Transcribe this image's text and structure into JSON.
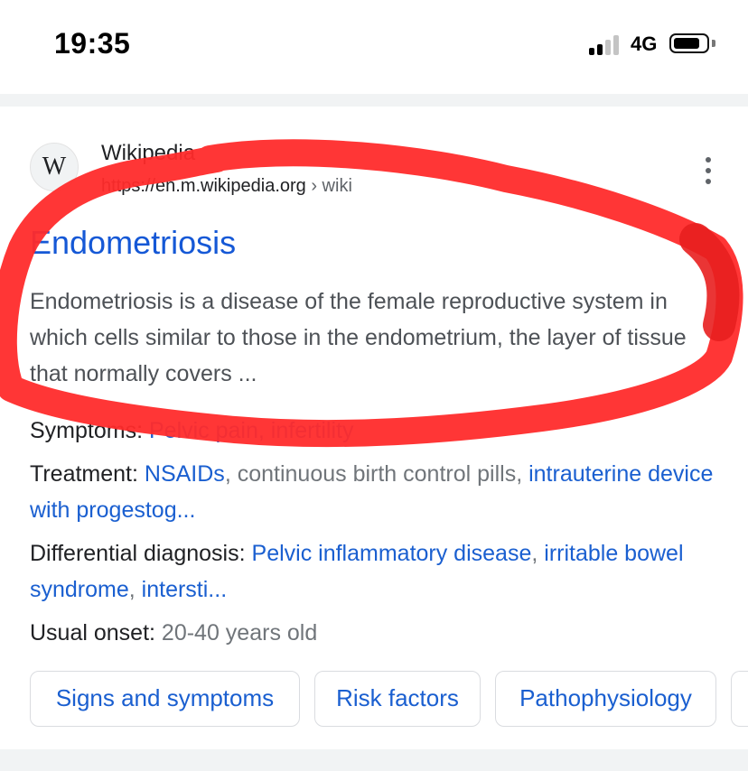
{
  "status_bar": {
    "time": "19:35",
    "network": "4G",
    "signal_icon": "cell-signal-icon",
    "battery_icon": "battery-icon"
  },
  "result": {
    "favicon_letter": "W",
    "site_name": "Wikipedia",
    "url": "https://en.m.wikipedia.org",
    "breadcrumb": " › wiki",
    "more_icon": "more-vert-icon",
    "title": "Endometriosis",
    "snippet": "Endometriosis is a disease of the female reproductive system in which cells similar to those in the endometrium, the layer of tissue that normally covers ...",
    "facts": {
      "symptoms": {
        "label": "Symptoms: ",
        "link1": "Pelvic pain",
        "sep1": ", ",
        "link2": "infertility"
      },
      "treatment": {
        "label": "Treatment: ",
        "link1": "NSAIDs",
        "text1": ", continuous birth control pills, ",
        "link2": "intrauterine device with progestog..."
      },
      "differential": {
        "label": "Differential diagnosis: ",
        "link1": "Pelvic inflammatory disease",
        "sep1": ", ",
        "link2": "irritable bowel syndrome",
        "sep2": ", ",
        "link3": "intersti..."
      },
      "onset": {
        "label": "Usual onset: ",
        "value": "20-40 years old"
      }
    },
    "chips": [
      "Signs and symptoms",
      "Risk factors",
      "Pathophysiology"
    ]
  },
  "colors": {
    "link": "#1a5fd0",
    "annotation": "#ff2b2b"
  }
}
